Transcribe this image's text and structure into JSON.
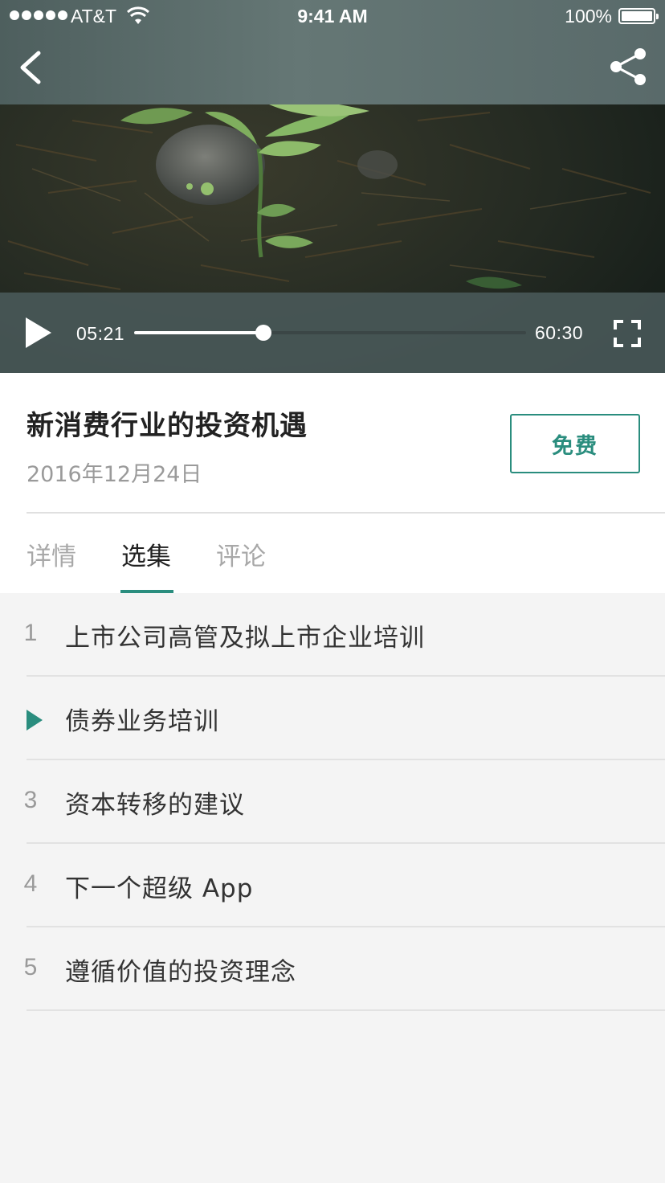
{
  "status_bar": {
    "carrier": "AT&T",
    "time": "9:41 AM",
    "battery": "100%",
    "battery_level": 1.0
  },
  "nav": {
    "back_icon": "chevron-left-icon",
    "share_icon": "share-icon"
  },
  "player": {
    "current_time": "05:21",
    "total_time": "60:30",
    "progress": 0.33,
    "play_icon": "play-icon",
    "fullscreen_icon": "fullscreen-icon"
  },
  "course": {
    "title": "新消费行业的投资机遇",
    "date": "2016年12月24日",
    "price_label": "免费"
  },
  "tabs": [
    {
      "label": "详情",
      "active": false
    },
    {
      "label": "选集",
      "active": true
    },
    {
      "label": "评论",
      "active": false
    }
  ],
  "episodes": [
    {
      "number": "1",
      "title": "上市公司高管及拟上市企业培训",
      "playing": false
    },
    {
      "number": "",
      "title": "债券业务培训",
      "playing": true
    },
    {
      "number": "3",
      "title": "资本转移的建议",
      "playing": false
    },
    {
      "number": "4",
      "title": "下一个超级 App",
      "playing": false
    },
    {
      "number": "5",
      "title": "遵循价值的投资理念",
      "playing": false
    }
  ],
  "colors": {
    "accent": "#2a8d7e",
    "title_text": "#222222",
    "muted_text": "#9a9a9a",
    "list_background": "#f4f4f4"
  }
}
